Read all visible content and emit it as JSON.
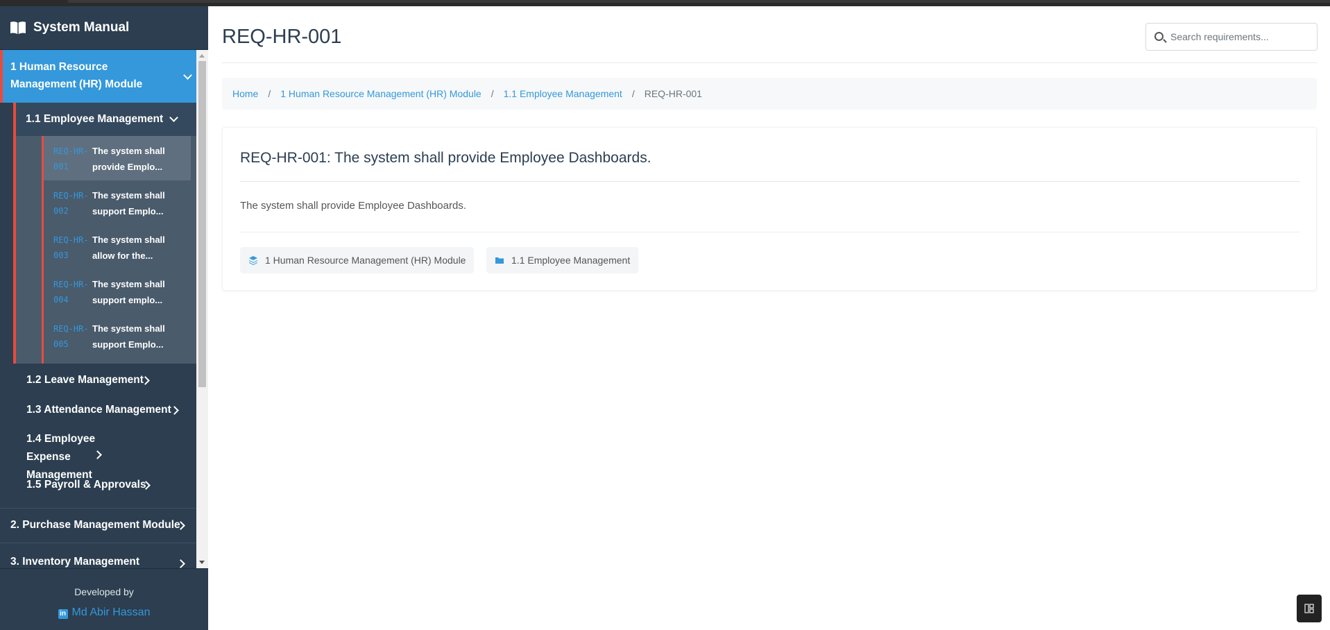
{
  "sidebar": {
    "title": "System Manual",
    "modules": [
      {
        "label": "1 Human Resource Management (HR) Module",
        "submodules": [
          {
            "label": "1.1 Employee Management",
            "requirements": [
              {
                "code": "REQ-HR-001",
                "text": "The system shall provide Emplo..."
              },
              {
                "code": "REQ-HR-002",
                "text": "The system shall support Emplo..."
              },
              {
                "code": "REQ-HR-003",
                "text": "The system shall allow for the..."
              },
              {
                "code": "REQ-HR-004",
                "text": "The system shall support emplo..."
              },
              {
                "code": "REQ-HR-005",
                "text": "The system shall support Emplo..."
              }
            ]
          },
          {
            "label": "1.2 Leave Management"
          },
          {
            "label": "1.3 Attendance Management"
          },
          {
            "label": "1.4 Employee Expense Management"
          },
          {
            "label": "1.5 Payroll & Approvals"
          }
        ]
      },
      {
        "label": "2. Purchase Management Module"
      },
      {
        "label": "3. Inventory Management"
      }
    ]
  },
  "footer": {
    "developed_by": "Developed by",
    "author": "Md Abir Hassan"
  },
  "main": {
    "title": "REQ-HR-001",
    "search_placeholder": "Search requirements...",
    "breadcrumb": [
      "Home",
      "1 Human Resource Management (HR) Module",
      "1.1 Employee Management",
      "REQ-HR-001"
    ],
    "breadcrumb_sep": "/",
    "card": {
      "heading": "REQ-HR-001: The system shall provide Employee Dashboards.",
      "description": "The system shall provide Employee Dashboards.",
      "tags": [
        "1 Human Resource Management (HR) Module",
        "1.1 Employee Management"
      ]
    }
  },
  "colors": {
    "sidebar_bg": "#2c3e50",
    "accent": "#3498db",
    "active_border": "#e74c3c"
  },
  "icons": [
    "book-icon",
    "chevron-down-icon",
    "chevron-right-icon",
    "search-icon",
    "layers-icon",
    "folder-icon",
    "linkedin-icon",
    "panel-icon"
  ]
}
